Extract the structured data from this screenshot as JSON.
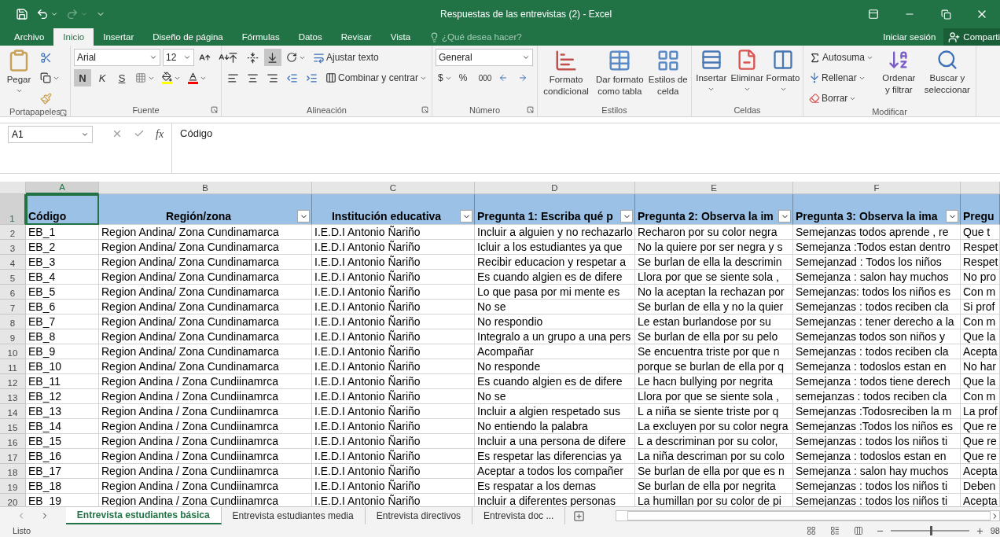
{
  "title_bar": {
    "title": "Respuestas de las entrevistas (2) - Excel"
  },
  "menu_tabs": [
    {
      "label": "Archivo",
      "selected": false
    },
    {
      "label": "Inicio",
      "selected": true
    },
    {
      "label": "Insertar",
      "selected": false
    },
    {
      "label": "Diseño de página",
      "selected": false
    },
    {
      "label": "Fórmulas",
      "selected": false
    },
    {
      "label": "Datos",
      "selected": false
    },
    {
      "label": "Revisar",
      "selected": false
    },
    {
      "label": "Vista",
      "selected": false
    }
  ],
  "search": {
    "placeholder": "¿Qué desea hacer?"
  },
  "account": {
    "sign_in": "Iniciar sesión",
    "share": "Comparti"
  },
  "ribbon": {
    "clipboard": {
      "title": "Portapapeles",
      "paste": "Pegar"
    },
    "font": {
      "title": "Fuente",
      "font_name": "Arial",
      "font_size": "12",
      "styles": [
        {
          "label": "N",
          "kind": "bold",
          "selected": true
        },
        {
          "label": "K",
          "kind": "italic",
          "selected": false
        },
        {
          "label": "S",
          "kind": "underline",
          "selected": false
        }
      ]
    },
    "alignment": {
      "title": "Alineación",
      "vertical": [
        {
          "kind": "top",
          "selected": false
        },
        {
          "kind": "middle",
          "selected": false
        },
        {
          "kind": "bottom",
          "selected": true
        }
      ],
      "wrap": "Ajustar texto",
      "merge": "Combinar y centrar"
    },
    "number": {
      "title": "Número",
      "format": "General",
      "currency": "$",
      "percent": "%",
      "thousands": "000"
    },
    "styles": {
      "title": "Estilos",
      "buttons": [
        {
          "label": "Formato condicional",
          "kind": "conditional"
        },
        {
          "label": "Dar formato como tabla",
          "kind": "table"
        },
        {
          "label": "Estilos de celda",
          "kind": "cell"
        }
      ]
    },
    "cells": {
      "title": "Celdas",
      "buttons": [
        {
          "label": "Insertar",
          "kind": "insert"
        },
        {
          "label": "Eliminar",
          "kind": "delete"
        },
        {
          "label": "Formato",
          "kind": "format"
        }
      ]
    },
    "editing": {
      "title": "Modificar",
      "autosum": "Autosuma",
      "fill": "Rellenar",
      "clear": "Borrar",
      "sort": "Ordenar y filtrar",
      "find": "Buscar y seleccionar"
    }
  },
  "formula_bar": {
    "name_box": "A1",
    "fx": "fx",
    "content": "Código"
  },
  "sheet": {
    "columns": [
      {
        "letter": "A",
        "selected": true,
        "header": "Código",
        "filter": false
      },
      {
        "letter": "B",
        "selected": false,
        "header": "Región/zona",
        "filter": true
      },
      {
        "letter": "C",
        "selected": false,
        "header": "Institución educativa",
        "filter": true
      },
      {
        "letter": "D",
        "selected": false,
        "header": "Pregunta 1: Escriba qué p",
        "filter": true
      },
      {
        "letter": "E",
        "selected": false,
        "header": "Pregunta 2: Observa la im",
        "filter": true
      },
      {
        "letter": "F",
        "selected": false,
        "header": "Pregunta 3: Observa la ima",
        "filter": true
      },
      {
        "selected": false,
        "header": "Pregu",
        "filter": false
      }
    ],
    "header_row": {
      "number": "1",
      "selected": true
    },
    "rows": [
      {
        "number": "2",
        "selected": false,
        "cells": [
          "EB_1",
          "Region Andina/ Zona Cundinamarca",
          "I.E.D.I Antonio Ñariño",
          "Incluir a alguien y no rechazarlo",
          "Recharon por su color negra",
          "Semejanzas todos aprende , re",
          "Que t"
        ]
      },
      {
        "number": "3",
        "selected": false,
        "cells": [
          "EB_2",
          "Region Andina/ Zona Cundinamarca",
          "I.E.D.I Antonio Ñariño",
          "Icluir a los estudiantes ya que",
          "No la quiere por ser negra y s",
          "Semejanza :Todos estan dentro",
          "Respet"
        ]
      },
      {
        "number": "4",
        "selected": false,
        "cells": [
          "EB_3",
          "Region Andina/ Zona Cundinamarca",
          "I.E.D.I Antonio Ñariño",
          "Recibir educacion y respetar a",
          "Se burlan de ella la descrimin",
          "Semejanzad :  Todos  los niños",
          "Respet"
        ]
      },
      {
        "number": "5",
        "selected": false,
        "cells": [
          "EB_4",
          "Region Andina/ Zona Cundinamarca",
          "I.E.D.I Antonio Ñariño",
          "Es cuando algien es de  difere",
          "Llora por que se siente sola ,",
          "Semejanza : salon hay muchos",
          "No pro"
        ]
      },
      {
        "number": "6",
        "selected": false,
        "cells": [
          "EB_5",
          "Region Andina/ Zona Cundinamarca",
          "I.E.D.I Antonio Ñariño",
          "Lo que pasa por mi mente es",
          "No la aceptan la  rechazan por",
          "Semejanzas: todos los niños es",
          "Con m"
        ]
      },
      {
        "number": "7",
        "selected": false,
        "cells": [
          "EB_6",
          "Region Andina/ Zona Cundinamarca",
          "I.E.D.I Antonio Ñariño",
          "No  se",
          "Se burlan de ella y no la quier",
          "Semejanzas : todos reciben cla",
          "Si prof"
        ]
      },
      {
        "number": "8",
        "selected": false,
        "cells": [
          "EB_7",
          "Region Andina/ Zona Cundinamarca",
          "I.E.D.I Antonio Ñariño",
          "No respondio",
          "Le estan burlandose  por  su",
          "Semejanzas : tener derecho a la",
          "Con m"
        ]
      },
      {
        "number": "9",
        "selected": false,
        "cells": [
          "EB_8",
          "Region Andina/ Zona Cundinamarca",
          "I.E.D.I Antonio Ñariño",
          "Integralo a un grupo a una pers",
          "Se burlan de ella por su pelo",
          "Semejanzas  todos son niños y",
          "Que la"
        ]
      },
      {
        "number": "10",
        "selected": false,
        "cells": [
          "EB_9",
          "Region Andina/ Zona Cundinamarca",
          "I.E.D.I Antonio Ñariño",
          "Acompañar",
          "Se encuentra triste por que n",
          "Semejanzas : todos reciben cla",
          "Acepta"
        ]
      },
      {
        "number": "11",
        "selected": false,
        "cells": [
          "EB_10",
          "Region Andina/ Zona Cundinamarca",
          "I.E.D.I Antonio Ñariño",
          "No responde",
          "porque se burlan de ella por q",
          "Semejanza : todoslos estan en",
          "No har"
        ]
      },
      {
        "number": "12",
        "selected": false,
        "cells": [
          "EB_11",
          "Region Andina / Zona  Cundiinamrca",
          "I.E.D.I Antonio Ñariño",
          "Es cuando algien es de  difere",
          "Le hacn bullying por  negrita",
          "Semejanza : todos tiene derech",
          "Que la"
        ]
      },
      {
        "number": "13",
        "selected": false,
        "cells": [
          "EB_12",
          "Region Andina / Zona  Cundiinamrca",
          "I.E.D.I Antonio Ñariño",
          "No se",
          "Llora por que se siente sola ,",
          "semejanzas : todos reciben cla",
          "Con m"
        ]
      },
      {
        "number": "14",
        "selected": false,
        "cells": [
          "EB_13",
          "Region Andina / Zona  Cundiinamrca",
          "I.E.D.I Antonio Ñariño",
          "Incluir a algien respetado sus",
          "L a niña se siente triste por q",
          "Semejanzas :Todosreciben la m",
          "La prof"
        ]
      },
      {
        "number": "15",
        "selected": false,
        "cells": [
          "EB_14",
          "Region Andina / Zona  Cundiinamrca",
          "I.E.D.I Antonio Ñariño",
          "No entiendo la palabra",
          "La excluyen por su color negra",
          "Semejanzas :Todos los niños es",
          "Que re"
        ]
      },
      {
        "number": "16",
        "selected": false,
        "cells": [
          "EB_15",
          "Region Andina / Zona  Cundiinamrca",
          "I.E.D.I Antonio Ñariño",
          "Incluir a una persona de difere",
          "L a descriminan  por su color,",
          "Semejanzas : todos los niños ti",
          "Que re"
        ]
      },
      {
        "number": "17",
        "selected": false,
        "cells": [
          "EB_16",
          "Region Andina / Zona  Cundiinamrca",
          "I.E.D.I Antonio Ñariño",
          "Es respetar las diferencias ya",
          "La niña descriman por su colo",
          "Semejanza : todoslos estan en",
          "Que re"
        ]
      },
      {
        "number": "18",
        "selected": false,
        "cells": [
          "EB_17",
          "Region Andina / Zona  Cundiinamrca",
          "I.E.D.I Antonio Ñariño",
          "Aceptar a todos los compañer",
          "Se burlan de ella por que es n",
          "Semejanza : salon hay muchos",
          "Acepta"
        ]
      },
      {
        "number": "19",
        "selected": false,
        "cells": [
          "EB_18",
          "Region Andina / Zona  Cundiinamrca",
          "I.E.D.I Antonio Ñariño",
          "Es respatar a los demas",
          "Se burlan de ella por negrita",
          "Semejanzas : todos los niños ti",
          "Deben"
        ]
      },
      {
        "number": "20",
        "selected": false,
        "cells": [
          "EB_19",
          "Region Andina / Zona  Cundiinamrca",
          "I.E.D.I Antonio Ñariño",
          "Incluir a diferentes  personas",
          "La humillan por su color de pi",
          "Semejanzas : todos los niños ti",
          "Acepta"
        ]
      }
    ]
  },
  "sheet_tabs": [
    {
      "label": "Entrevista estudiantes básica",
      "selected": true
    },
    {
      "label": "Entrevista estudiantes media",
      "selected": false
    },
    {
      "label": "Entrevista directivos",
      "selected": false
    },
    {
      "label": "Entrevista doc ...",
      "selected": false
    }
  ],
  "status_bar": {
    "text": "Listo",
    "zoom": {
      "level": 0.5,
      "reading": "98"
    }
  }
}
